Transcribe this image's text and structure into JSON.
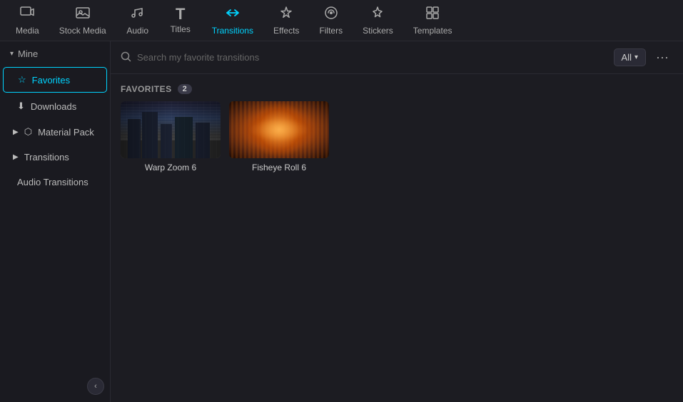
{
  "topNav": {
    "items": [
      {
        "id": "media",
        "label": "Media",
        "icon": "🎬",
        "active": false
      },
      {
        "id": "stock-media",
        "label": "Stock Media",
        "icon": "🖼",
        "active": false
      },
      {
        "id": "audio",
        "label": "Audio",
        "icon": "🎵",
        "active": false
      },
      {
        "id": "titles",
        "label": "Titles",
        "icon": "T",
        "active": false
      },
      {
        "id": "transitions",
        "label": "Transitions",
        "icon": "⇄",
        "active": true
      },
      {
        "id": "effects",
        "label": "Effects",
        "icon": "✦",
        "active": false
      },
      {
        "id": "filters",
        "label": "Filters",
        "icon": "◈",
        "active": false
      },
      {
        "id": "stickers",
        "label": "Stickers",
        "icon": "★",
        "active": false
      },
      {
        "id": "templates",
        "label": "Templates",
        "icon": "⊞",
        "active": false
      }
    ]
  },
  "sidebar": {
    "mine_label": "Mine",
    "favorites_label": "Favorites",
    "downloads_label": "Downloads",
    "material_pack_label": "Material Pack",
    "transitions_label": "Transitions",
    "audio_transitions_label": "Audio Transitions",
    "collapse_icon": "‹"
  },
  "search": {
    "placeholder": "Search my favorite transitions",
    "filter_label": "All",
    "more_icon": "···"
  },
  "favoritesSection": {
    "label": "FAVORITES",
    "count": "2"
  },
  "thumbnails": [
    {
      "id": "warp-zoom-6",
      "label": "Warp Zoom 6",
      "type": "warp-zoom"
    },
    {
      "id": "fisheye-roll-6",
      "label": "Fisheye Roll 6",
      "type": "fisheye"
    }
  ]
}
